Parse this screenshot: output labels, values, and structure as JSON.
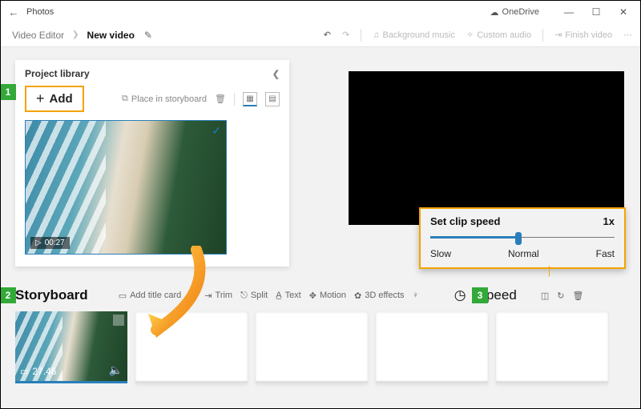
{
  "titlebar": {
    "app_name": "Photos",
    "onedrive_label": "OneDrive"
  },
  "breadcrumb": {
    "parent": "Video Editor",
    "current": "New video",
    "tools": {
      "undo": "↶",
      "redo": "↷",
      "bg_music": "Background music",
      "custom_audio": "Custom audio",
      "finish": "Finish video"
    }
  },
  "library": {
    "title": "Project library",
    "add_label": "Add",
    "place_label": "Place in storyboard",
    "clip_time": "00:27"
  },
  "storyboard": {
    "title": "Storyboard",
    "tools": {
      "add_title": "Add title card",
      "trim": "Trim",
      "split": "Split",
      "text": "Text",
      "motion": "Motion",
      "effects": "3D effects",
      "speed": "Speed"
    },
    "clip_duration": "27.46"
  },
  "speed_popup": {
    "title": "Set clip speed",
    "value": "1x",
    "slow": "Slow",
    "normal": "Normal",
    "fast": "Fast"
  },
  "callouts": {
    "c1": "1",
    "c2": "2",
    "c3": "3"
  }
}
